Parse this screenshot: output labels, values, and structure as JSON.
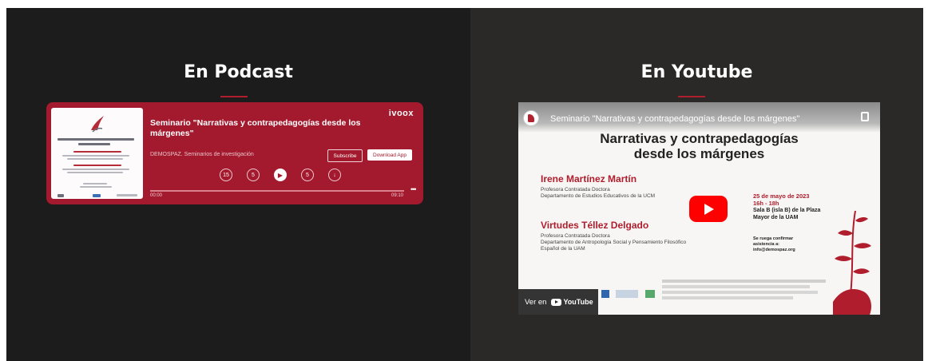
{
  "podcast": {
    "heading": "En Podcast",
    "brand": "ivoox",
    "episode_title": "Seminario \"Narrativas y contrapedagogías desde los márgenes\"",
    "channel": "DEMOSPAZ. Seminarios de investigación",
    "subscribe_label": "Subscribe",
    "download_label": "Download App",
    "rewind_label": "15",
    "back_label": "5",
    "forward_label": "5",
    "skip_label": "15",
    "time_current": "00:00",
    "time_total": "09:10",
    "more": "•••",
    "progress": 0
  },
  "youtube": {
    "heading": "En Youtube",
    "video_title": "Seminario \"Narrativas y contrapedagogías desde los márgenes\"",
    "poster_title_line1": "Narrativas y contrapedagogías",
    "poster_title_line2": "desde los márgenes",
    "speaker1_name": "Irene Martínez Martín",
    "speaker1_role_line1": "Profesora Contratada Doctora",
    "speaker1_role_line2": "Departamento de Estudios Educativos de la UCM",
    "speaker2_name": "Virtudes Téllez Delgado",
    "speaker2_role_line1": "Profesora Contratada Doctora",
    "speaker2_role_line2": "Departamento de Antropología Social y Pensamiento Filosófico",
    "speaker2_role_line3": "Español de la UAM",
    "date_line1": "25 de mayo de 2023",
    "date_line2": "16h - 18h",
    "place_line1": "Sala B (isla B) de la Plaza",
    "place_line2": "Mayor de la UAM",
    "confirm_line1": "Se ruega confirmar",
    "confirm_line2": "asistencia a:",
    "confirm_line3": "info@demospaz.org",
    "watch_label": "Ver en",
    "yt_brand": "YouTube"
  },
  "colors": {
    "accent": "#b01d2c",
    "player_bg": "#a3192d",
    "left_bg": "#1d1c1c",
    "right_bg": "#2a2928"
  }
}
